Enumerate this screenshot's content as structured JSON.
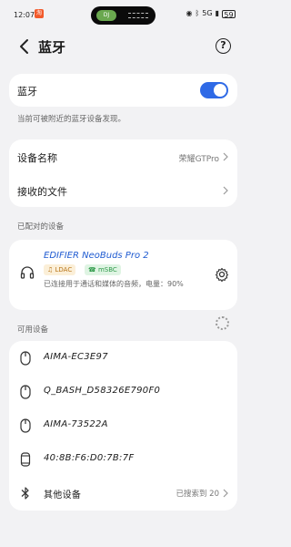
{
  "status_bar": {
    "time": "12:07",
    "app_badge": "淘",
    "island_media_label": "DJ",
    "network_label": "5G",
    "wifi_label": "Wi-Fi",
    "battery": "59"
  },
  "header": {
    "back_icon": "chevron-left-icon",
    "title": "蓝牙",
    "help_icon": "help-circle-icon"
  },
  "bluetooth_toggle": {
    "label": "蓝牙",
    "enabled": true,
    "hint": "当前可被附近的蓝牙设备发现。"
  },
  "settings": {
    "device_name_label": "设备名称",
    "device_name_value": "荣耀GTPro",
    "received_files_label": "接收的文件"
  },
  "paired": {
    "section_title": "已配对的设备",
    "device": {
      "name": "EDIFIER NeoBuds Pro 2",
      "codec_1": "LDAC",
      "codec_2": "mSBC",
      "status": "已连接用于通话和媒体的音频，电量：90%",
      "icon": "headphone-icon"
    }
  },
  "available": {
    "section_title": "可用设备",
    "devices": [
      {
        "name": "AIMA-EC3E97",
        "icon": "mouse-icon"
      },
      {
        "name": "Q_BASH_D58326E790F0",
        "icon": "mouse-icon"
      },
      {
        "name": "AIMA-73522A",
        "icon": "mouse-icon"
      },
      {
        "name": "40:8B:F6:D0:7B:7F",
        "icon": "generic-device-icon"
      }
    ],
    "other_devices_label": "其他设备",
    "other_devices_value": "已搜索到 20",
    "other_devices_icon": "bluetooth-icon"
  },
  "colors": {
    "accent": "#2f6ae6",
    "background": "#f2f2f4",
    "card": "#ffffff"
  }
}
